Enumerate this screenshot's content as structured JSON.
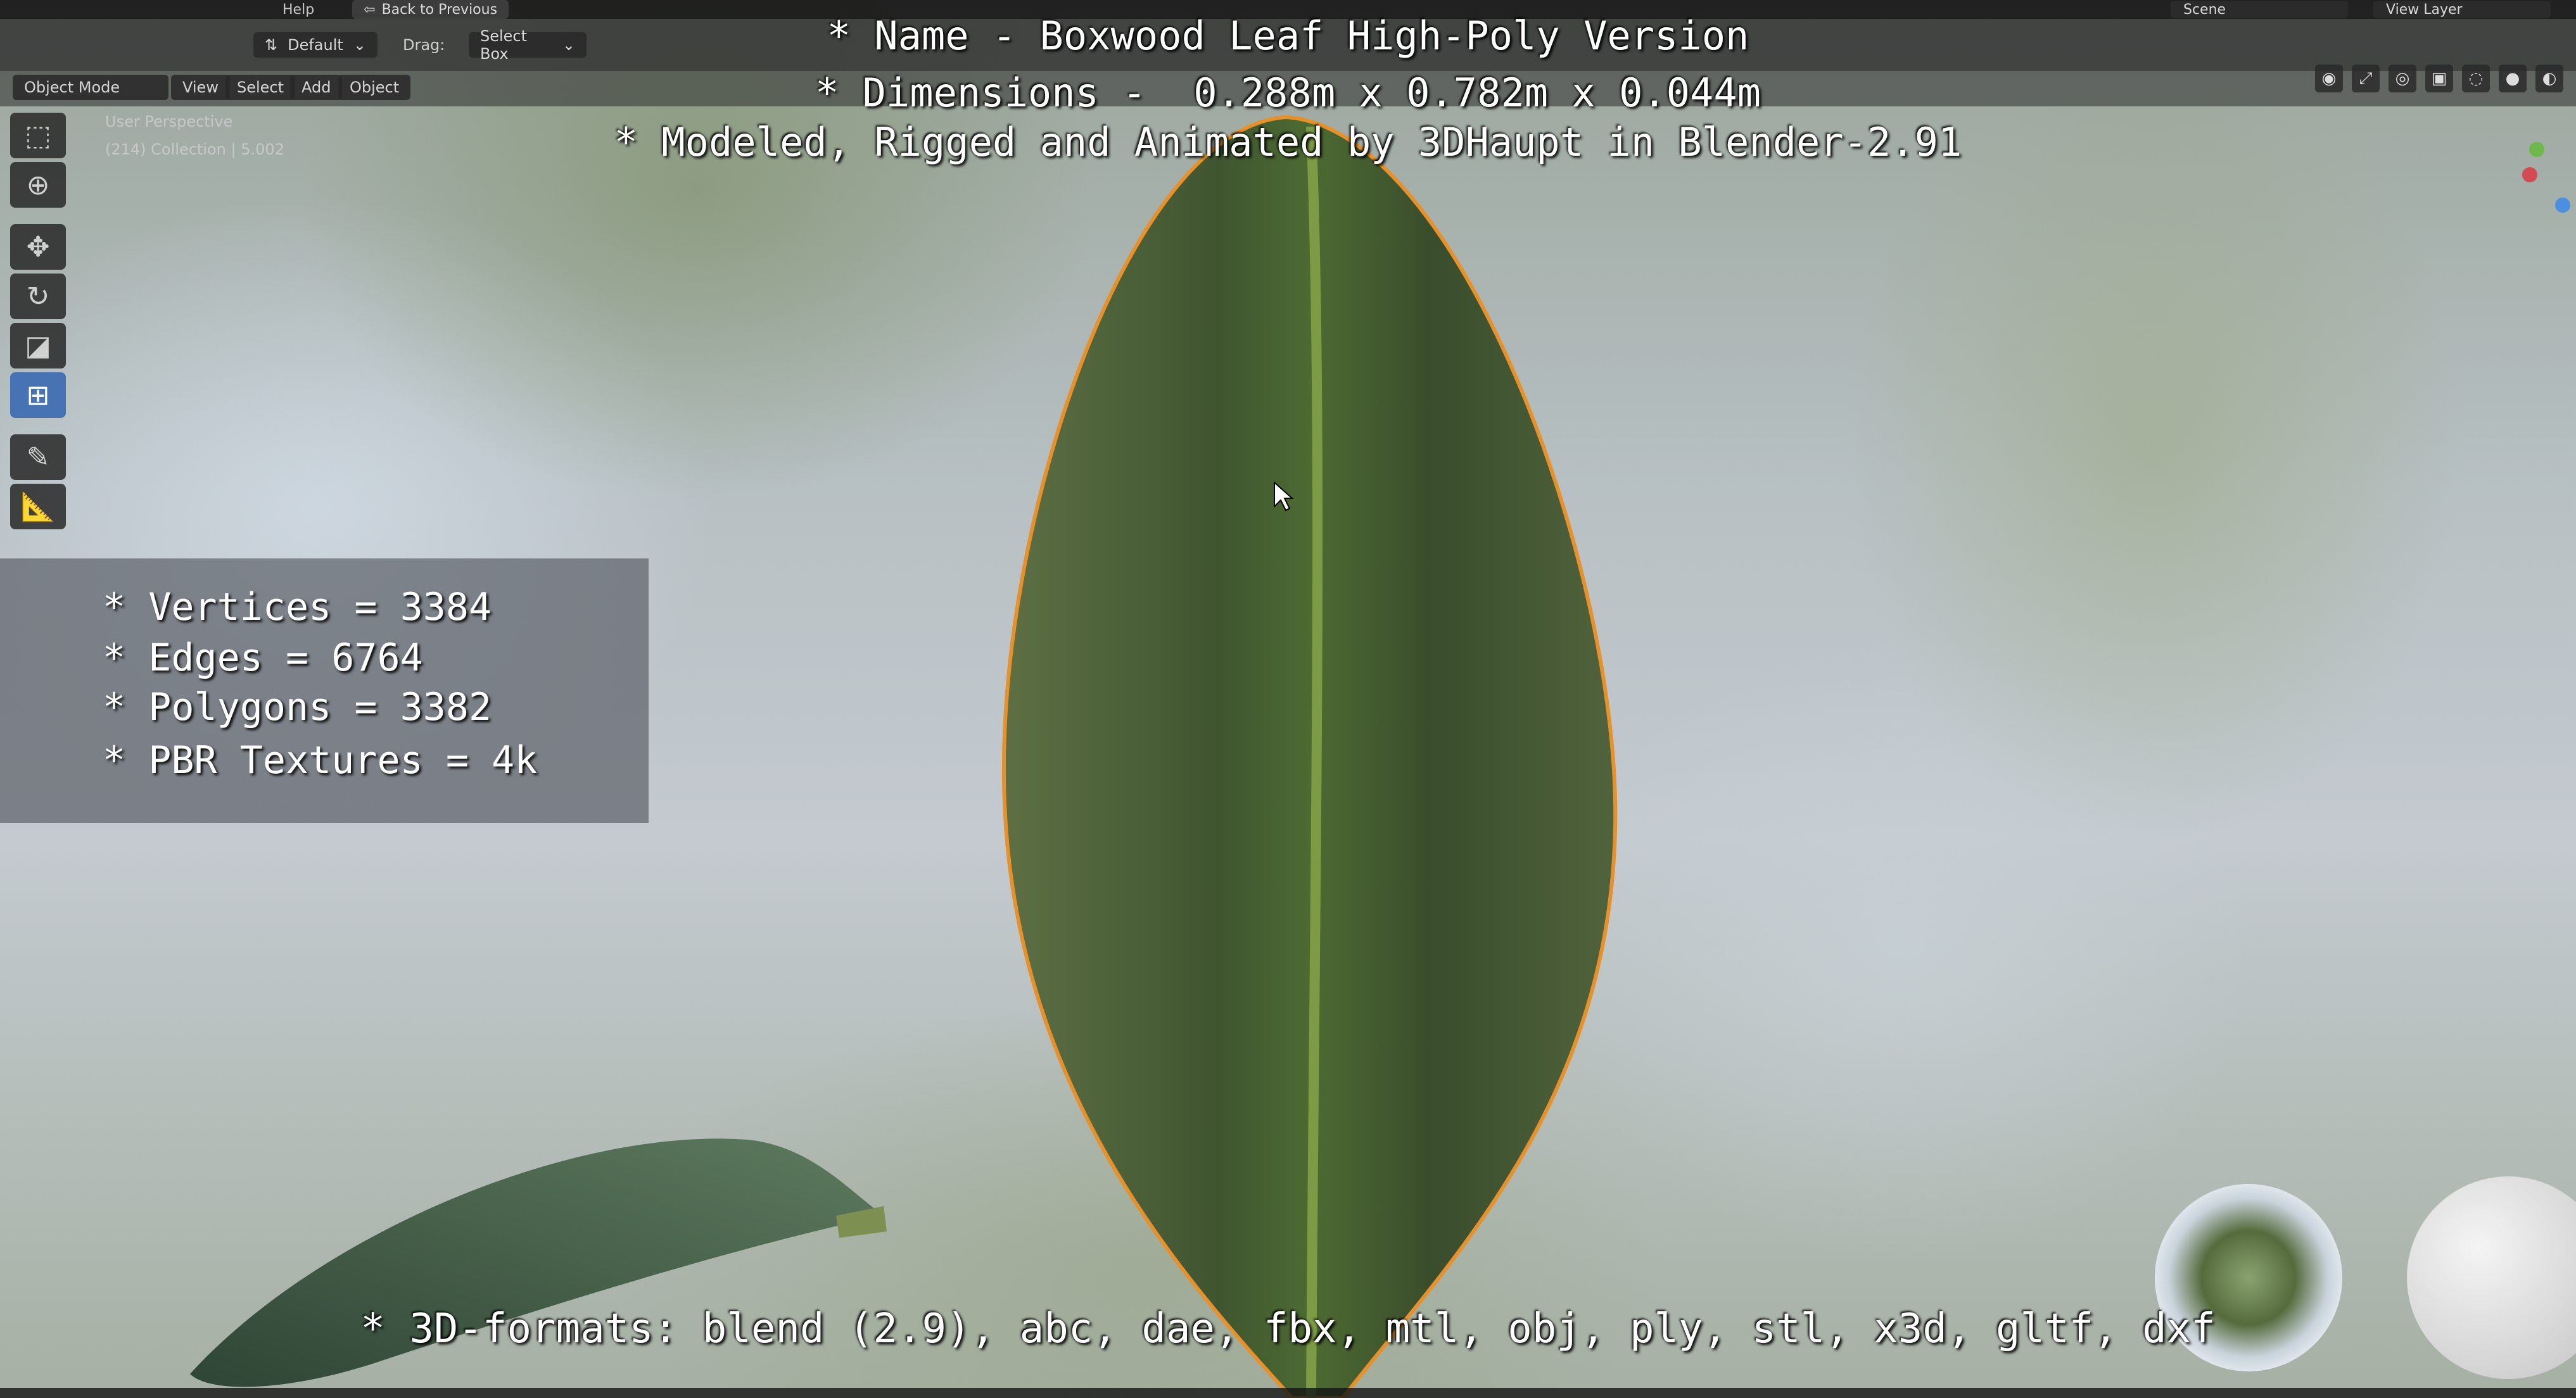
{
  "top_menu": {
    "help": "Help",
    "back_to_previous": "Back to Previous",
    "scene": "Scene",
    "view_layer": "View Layer"
  },
  "header": {
    "orientation_value": "Default",
    "drag_label": "Drag:",
    "drag_value": "Select Box"
  },
  "viewport_header": {
    "mode": "Object Mode",
    "view": "View",
    "select": "Select",
    "add": "Add",
    "object": "Object"
  },
  "viewport_info": {
    "perspective": "User Perspective",
    "collection": "(214) Collection | 5.002"
  },
  "title_lines": {
    "name": "* Name - Boxwood Leaf High-Poly Version",
    "dimensions": "* Dimensions -  0.288m x 0.782m x 0.044m",
    "credits": "* Modeled, Rigged and Animated by 3DHaupt in Blender-2.91"
  },
  "stats": {
    "vertices": "* Vertices = 3384",
    "edges": "* Edges = 6764",
    "polygons": "* Polygons = 3382",
    "textures": "* PBR Textures = 4k"
  },
  "formats": "* 3D-formats: blend (2.9), abc, dae, fbx, mtl, obj, ply, stl, x3d, gltf, dxf",
  "colors": {
    "leaf": "#4a6136",
    "outline": "#e8912a",
    "active_tool": "#4772b3"
  },
  "icons": [
    "select-box-icon",
    "cursor-icon",
    "move-icon",
    "rotate-icon",
    "scale-icon",
    "transform-icon",
    "annotate-icon",
    "measure-icon"
  ]
}
